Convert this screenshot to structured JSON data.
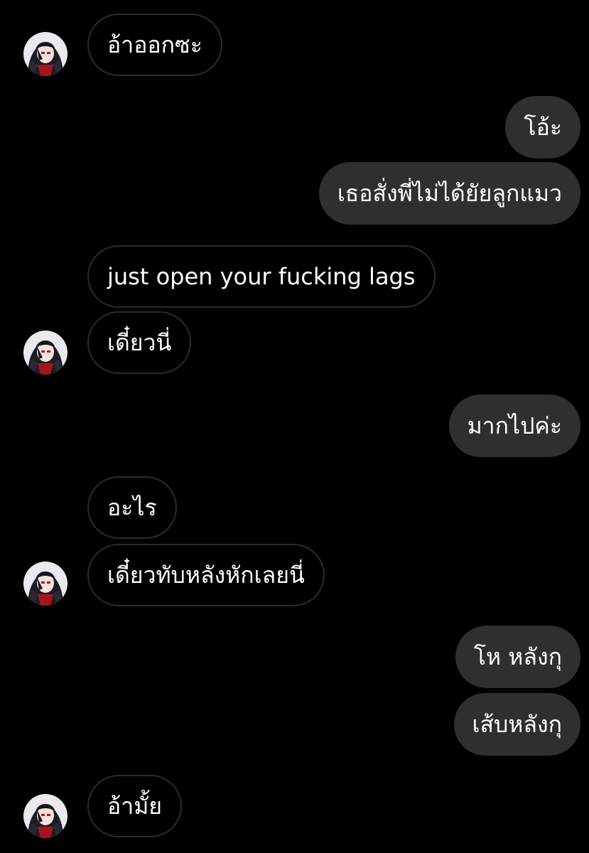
{
  "colors": {
    "background": "#000000",
    "incoming_bubble_border": "#2b2b2b",
    "outgoing_bubble_fill": "#2f2f2f",
    "text": "#ffffff"
  },
  "avatar_icon": "anime-character-avatar-icon",
  "messages": [
    {
      "direction": "incoming",
      "text": "อ้าออกซะ"
    },
    {
      "direction": "outgoing",
      "text": "โอ้ะ"
    },
    {
      "direction": "outgoing",
      "text": "เธอสั่งพี่ไม่ได้ยัยลูกแมว"
    },
    {
      "direction": "incoming",
      "text": "just open your fucking lags"
    },
    {
      "direction": "incoming",
      "text": "เดี๋ยวนี่"
    },
    {
      "direction": "outgoing",
      "text": "มากไปค่ะ"
    },
    {
      "direction": "incoming",
      "text": "อะไร"
    },
    {
      "direction": "incoming",
      "text": "เดี๋ยวทับหลังหักเลยนี่"
    },
    {
      "direction": "outgoing",
      "text": "โห หลังกุ"
    },
    {
      "direction": "outgoing",
      "text": "เส้บหลังกุ"
    },
    {
      "direction": "incoming",
      "text": "อ้ามั้ย"
    }
  ]
}
